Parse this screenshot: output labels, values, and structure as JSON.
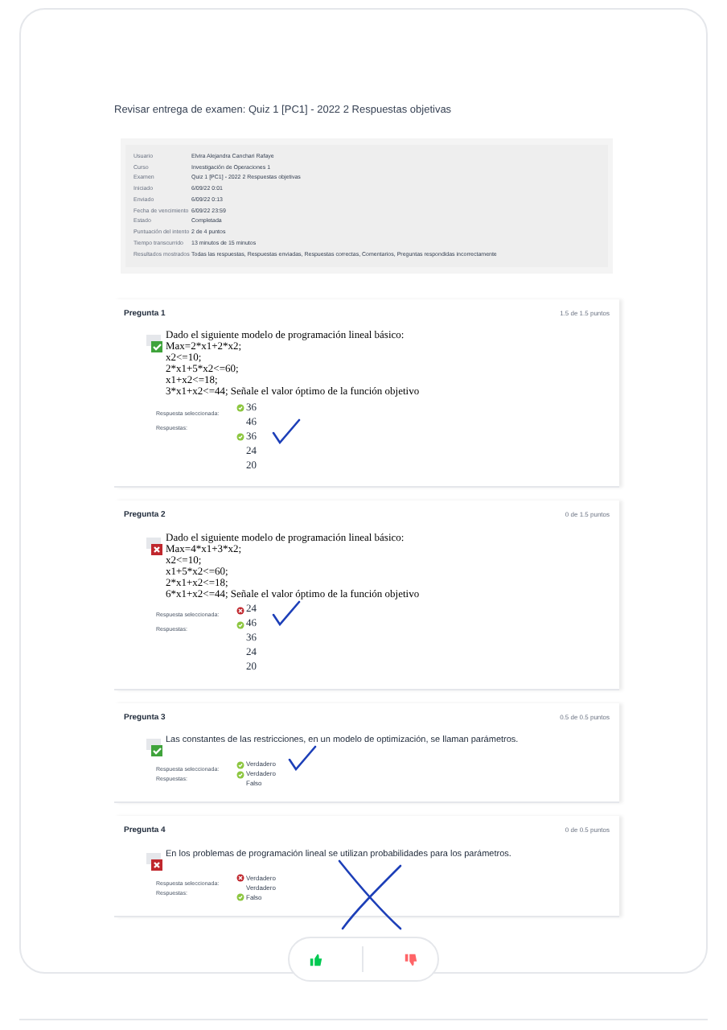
{
  "title": "Revisar entrega de examen: Quiz 1 [PC1] - 2022 2 Respuestas objetivas",
  "info": [
    {
      "label": "Usuario",
      "value": "Elvira Alejandra Canchari Rafaye"
    },
    {
      "label": "Curso",
      "value": "Investigación de Operaciones 1"
    },
    {
      "label": "Examen",
      "value": "Quiz 1 [PC1] - 2022 2 Respuestas objetivas"
    },
    {
      "label": "Iniciado",
      "value": "6/09/22 0:01"
    },
    {
      "label": "Enviado",
      "value": "6/09/22 0:13"
    },
    {
      "label": "Fecha de vencimiento",
      "value": "6/09/22 23:59"
    },
    {
      "label": "Estado",
      "value": "Completada"
    },
    {
      "label": "Puntuación del intento",
      "value": "2 de 4 puntos"
    },
    {
      "label": "Tiempo transcurrido",
      "value": "13 minutos de 15 minutos"
    },
    {
      "label": "Resultados mostrados",
      "value": "Todas las respuestas, Respuestas enviadas, Respuestas correctas, Comentarios, Preguntas respondidas incorrectamente"
    }
  ],
  "questions": [
    {
      "title": "Pregunta 1",
      "score": "1.5 de 1.5 puntos",
      "correct": true,
      "kind": "formula",
      "annotation": {
        "kind": "check"
      },
      "lines": [
        "Dado el siguiente modelo de programación lineal básico:",
        "Max=2*x1+2*x2;",
        "x2<=10;",
        "2*x1+5*x2<=60;",
        "x1+x2<=18;",
        "3*x1+x2<=44; Señale el valor óptimo de la función objetivo"
      ],
      "selected_label": "Respuesta seleccionada:",
      "selected": {
        "text": "36",
        "correct": true
      },
      "answers_label": "Respuestas:",
      "answers": [
        {
          "text": "46",
          "correct": false
        },
        {
          "text": "36",
          "correct": true
        },
        {
          "text": "24",
          "correct": false
        },
        {
          "text": "20",
          "correct": false
        }
      ]
    },
    {
      "title": "Pregunta 2",
      "score": "0 de 1.5 puntos",
      "correct": false,
      "kind": "formula",
      "annotation": {
        "kind": "check"
      },
      "lines": [
        "Dado el siguiente modelo de programación lineal básico:",
        "Max=4*x1+3*x2;",
        "x2<=10;",
        "x1+5*x2<=60;",
        "2*x1+x2<=18;",
        "6*x1+x2<=44; Señale el valor óptimo de la función objetivo"
      ],
      "selected_label": "Respuesta seleccionada:",
      "selected": {
        "text": "24",
        "correct": false
      },
      "answers_label": "Respuestas:",
      "answers": [
        {
          "text": "46",
          "correct": true
        },
        {
          "text": "36",
          "correct": false
        },
        {
          "text": "24",
          "correct": false
        },
        {
          "text": "20",
          "correct": false
        }
      ]
    },
    {
      "title": "Pregunta 3",
      "score": "0.5 de 0.5 puntos",
      "correct": true,
      "kind": "statement",
      "annotation": {
        "kind": "check"
      },
      "lines": [
        "Las constantes de las restricciones, en un modelo de optimización, se llaman parámetros."
      ],
      "selected_label": "Respuesta seleccionada:",
      "selected": {
        "text": "Verdadero",
        "correct": true
      },
      "answers_label": "Respuestas:",
      "answers": [
        {
          "text": "Verdadero",
          "correct": true
        },
        {
          "text": "Falso",
          "correct": false
        }
      ]
    },
    {
      "title": "Pregunta 4",
      "score": "0 de 0.5 puntos",
      "correct": false,
      "kind": "statement",
      "annotation": {
        "kind": "cross"
      },
      "lines": [
        "En los problemas de programación lineal se utilizan probabilidades para los parámetros."
      ],
      "selected_label": "Respuesta seleccionada:",
      "selected": {
        "text": "Verdadero",
        "correct": false
      },
      "answers_label": "Respuestas:",
      "answers": [
        {
          "text": "Verdadero",
          "correct": false
        },
        {
          "text": "Falso",
          "correct": true
        }
      ]
    }
  ],
  "feedback": {
    "liked": false,
    "disliked": false
  }
}
